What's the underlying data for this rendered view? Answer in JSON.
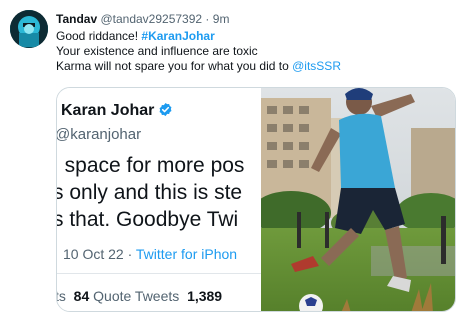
{
  "tweet": {
    "author_name": "Tandav",
    "author_handle": "@tandav29257392",
    "separator": "·",
    "timestamp": "9m",
    "line1_prefix": "Good riddance! ",
    "line1_hashtag": "#KaranJohar",
    "line2": "Your existence and influence are toxic",
    "line3_prefix": "Karma will not spare you for what you did to ",
    "line3_mention": "@itsSSR"
  },
  "quoted_tweet": {
    "name": "Karan Johar",
    "handle": "@karanjohar",
    "text_line1": "space for more pos",
    "text_line2": "s only and this is ste",
    "text_line3": "s that. Goodbye Twi",
    "date": "10 Oct 22",
    "dot": "·",
    "source": "Twitter for iPhon",
    "stats_prefix": "ts",
    "quote_count": "84",
    "quote_label": "Quote Tweets",
    "like_count": "1,389"
  },
  "colors": {
    "link": "#1d9bf0",
    "muted": "#536471",
    "verified": "#1d9bf0",
    "jersey": "#3aa6d6"
  },
  "icons": {
    "verified": "verified-badge-icon"
  }
}
